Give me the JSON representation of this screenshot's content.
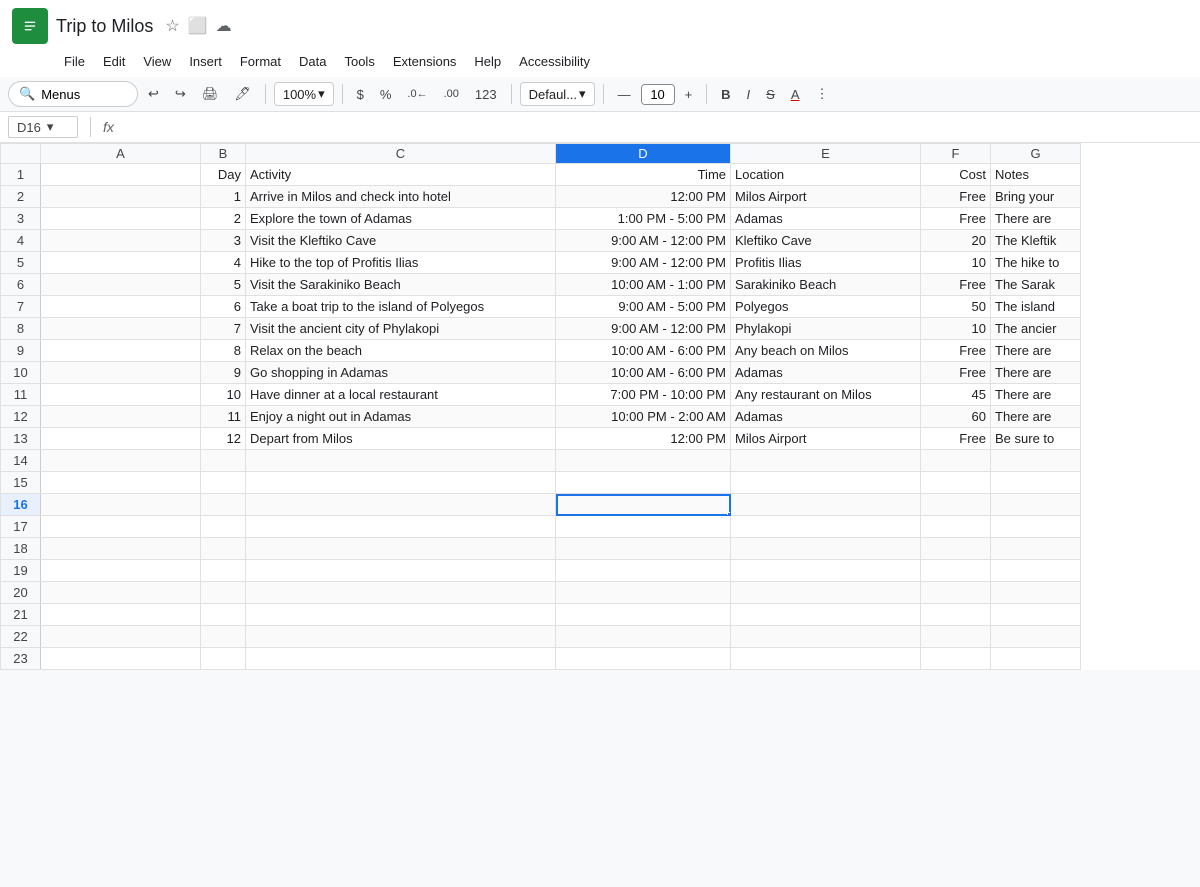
{
  "titleBar": {
    "appName": "Trip to Milos",
    "starLabel": "★",
    "docIcon": "📄",
    "cloudIcon": "☁"
  },
  "menuBar": {
    "items": [
      "File",
      "Edit",
      "View",
      "Insert",
      "Format",
      "Data",
      "Tools",
      "Extensions",
      "Help",
      "Accessibility"
    ]
  },
  "toolbar": {
    "searchPlaceholder": "Menus",
    "zoom": "100%",
    "dollarSign": "$",
    "percent": "%",
    "decimalDecrease": ".0←",
    "decimalIncrease": ".00",
    "formatNumber": "123",
    "fontFormat": "Defaul...",
    "fontSizeMinus": "—",
    "fontSize": "10",
    "fontSizePlus": "+",
    "bold": "B",
    "italic": "I",
    "strikethrough": "S̶",
    "underlineColor": "A"
  },
  "formulaBar": {
    "cellRef": "D16",
    "dropdownIcon": "▼",
    "fxLabel": "fx"
  },
  "columns": {
    "headers": [
      "",
      "A",
      "B",
      "C",
      "D",
      "E",
      "F",
      "G"
    ],
    "labels": {
      "A": "",
      "B": "Day",
      "C": "Activity",
      "D": "Time",
      "E": "Location",
      "F": "Cost",
      "G": "Notes"
    }
  },
  "rows": [
    {
      "row": 1,
      "A": "",
      "B": "Day",
      "C": "Activity",
      "D": "Time",
      "E": "Location",
      "F": "Cost",
      "G": "Notes",
      "isHeader": true
    },
    {
      "row": 2,
      "A": "",
      "B": "1",
      "C": "Arrive in Milos and check into hotel",
      "D": "12:00 PM",
      "E": "Milos Airport",
      "F": "Free",
      "G": "Bring your"
    },
    {
      "row": 3,
      "A": "",
      "B": "2",
      "C": "Explore the town of Adamas",
      "D": "1:00 PM - 5:00 PM",
      "E": "Adamas",
      "F": "Free",
      "G": "There are"
    },
    {
      "row": 4,
      "A": "",
      "B": "3",
      "C": "Visit the Kleftiko Cave",
      "D": "9:00 AM - 12:00 PM",
      "E": "Kleftiko Cave",
      "F": "20",
      "G": "The Kleftik"
    },
    {
      "row": 5,
      "A": "",
      "B": "4",
      "C": "Hike to the top of Profitis Ilias",
      "D": "9:00 AM - 12:00 PM",
      "E": "Profitis Ilias",
      "F": "10",
      "G": "The hike to"
    },
    {
      "row": 6,
      "A": "",
      "B": "5",
      "C": "Visit the Sarakiniko Beach",
      "D": "10:00 AM - 1:00 PM",
      "E": "Sarakiniko Beach",
      "F": "Free",
      "G": "The Sarak"
    },
    {
      "row": 7,
      "A": "",
      "B": "6",
      "C": "Take a boat trip to the island of Polyegos",
      "D": "9:00 AM - 5:00 PM",
      "E": "Polyegos",
      "F": "50",
      "G": "The island"
    },
    {
      "row": 8,
      "A": "",
      "B": "7",
      "C": "Visit the ancient city of Phylakopi",
      "D": "9:00 AM - 12:00 PM",
      "E": "Phylakopi",
      "F": "10",
      "G": "The ancier"
    },
    {
      "row": 9,
      "A": "",
      "B": "8",
      "C": "Relax on the beach",
      "D": "10:00 AM - 6:00 PM",
      "E": "Any beach on Milos",
      "F": "Free",
      "G": "There are"
    },
    {
      "row": 10,
      "A": "",
      "B": "9",
      "C": "Go shopping in Adamas",
      "D": "10:00 AM - 6:00 PM",
      "E": "Adamas",
      "F": "Free",
      "G": "There are"
    },
    {
      "row": 11,
      "A": "",
      "B": "10",
      "C": "Have dinner at a local restaurant",
      "D": "7:00 PM - 10:00 PM",
      "E": "Any restaurant on Milos",
      "F": "45",
      "G": "There are"
    },
    {
      "row": 12,
      "A": "",
      "B": "11",
      "C": "Enjoy a night out in Adamas",
      "D": "10:00 PM - 2:00 AM",
      "E": "Adamas",
      "F": "60",
      "G": "There are"
    },
    {
      "row": 13,
      "A": "",
      "B": "12",
      "C": "Depart from Milos",
      "D": "12:00 PM",
      "E": "Milos Airport",
      "F": "Free",
      "G": "Be sure to"
    },
    {
      "row": 14,
      "A": "",
      "B": "",
      "C": "",
      "D": "",
      "E": "",
      "F": "",
      "G": ""
    },
    {
      "row": 15,
      "A": "",
      "B": "",
      "C": "",
      "D": "",
      "E": "",
      "F": "",
      "G": ""
    },
    {
      "row": 16,
      "A": "",
      "B": "",
      "C": "",
      "D": "",
      "E": "",
      "F": "",
      "G": "",
      "isSelected": true
    },
    {
      "row": 17,
      "A": "",
      "B": "",
      "C": "",
      "D": "",
      "E": "",
      "F": "",
      "G": ""
    },
    {
      "row": 18,
      "A": "",
      "B": "",
      "C": "",
      "D": "",
      "E": "",
      "F": "",
      "G": ""
    },
    {
      "row": 19,
      "A": "",
      "B": "",
      "C": "",
      "D": "",
      "E": "",
      "F": "",
      "G": ""
    },
    {
      "row": 20,
      "A": "",
      "B": "",
      "C": "",
      "D": "",
      "E": "",
      "F": "",
      "G": ""
    },
    {
      "row": 21,
      "A": "",
      "B": "",
      "C": "",
      "D": "",
      "E": "",
      "F": "",
      "G": ""
    },
    {
      "row": 22,
      "A": "",
      "B": "",
      "C": "",
      "D": "",
      "E": "",
      "F": "",
      "G": ""
    },
    {
      "row": 23,
      "A": "",
      "B": "",
      "C": "",
      "D": "",
      "E": "",
      "F": "",
      "G": ""
    }
  ],
  "colors": {
    "selectedCellBorder": "#1a73e8",
    "headerBg": "#f8f9fa",
    "activeCellBg": "#e8f0fe",
    "gridLine": "#e0e0e0",
    "green": "#1e8e3e"
  }
}
